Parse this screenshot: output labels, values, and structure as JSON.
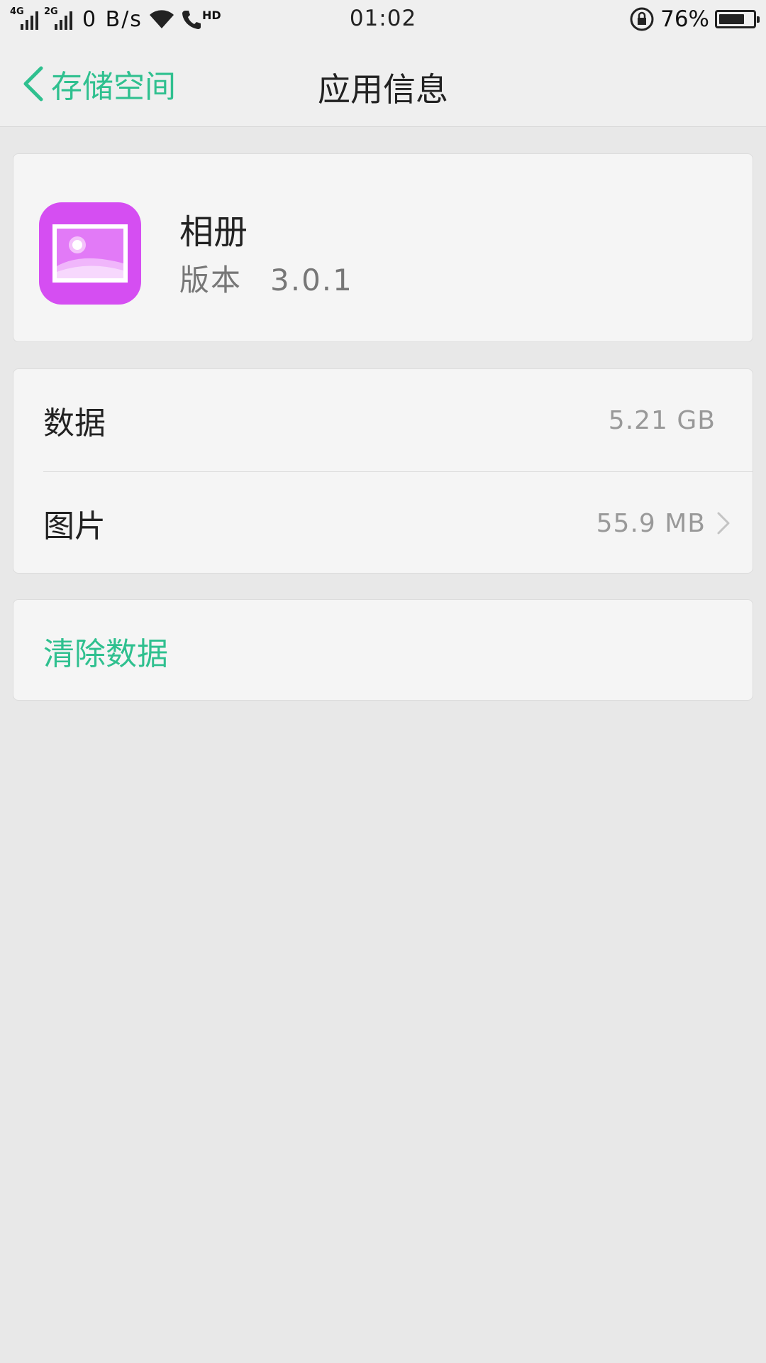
{
  "status_bar": {
    "net1": "4G",
    "net2": "2G",
    "net_speed": "0 B/s",
    "hd": "HD",
    "time": "01:02",
    "battery_percent": "76%",
    "battery_level": 0.76
  },
  "header": {
    "back_label": "存储空间",
    "title": "应用信息"
  },
  "app": {
    "name": "相册",
    "version_label": "版本",
    "version": "3.0.1",
    "icon": "gallery-icon",
    "icon_color": "#d54ef2"
  },
  "storage": {
    "rows": [
      {
        "label": "数据",
        "value": "5.21 GB"
      },
      {
        "label": "图片",
        "value": "55.9 MB"
      }
    ]
  },
  "actions": {
    "clear_data": "清除数据"
  },
  "colors": {
    "accent": "#2fc08f",
    "background": "#e8e8e8",
    "card": "#f5f5f5"
  }
}
